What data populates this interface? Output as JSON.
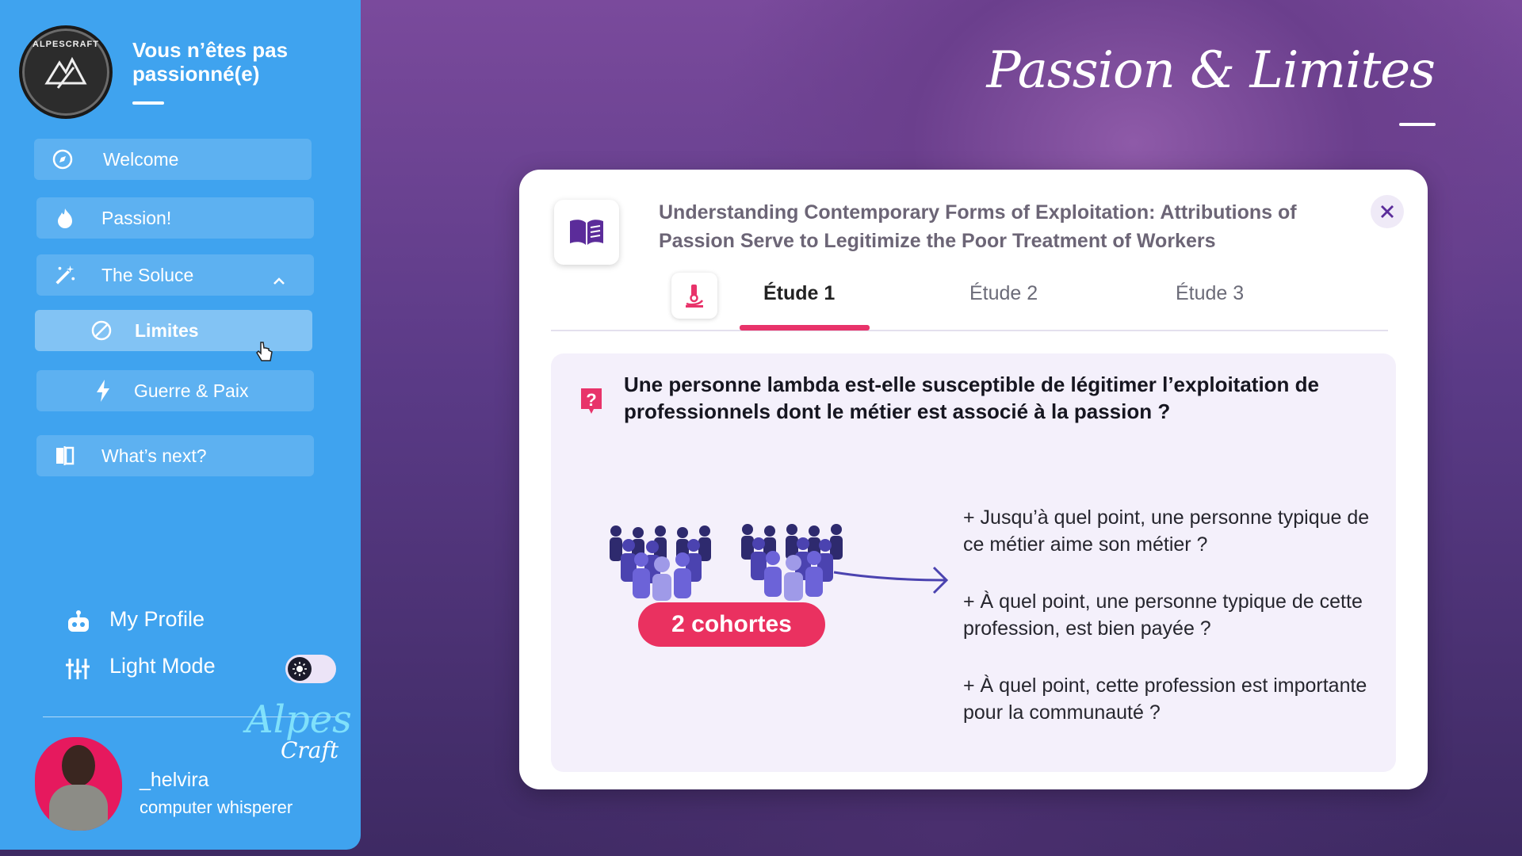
{
  "sidebar": {
    "logo_text": "ALPESCRAFT",
    "title": "Vous n’êtes pas passionné(e)",
    "nav": {
      "welcome": "Welcome",
      "passion": "Passion!",
      "soluce": "The Soluce",
      "limites": "Limites",
      "guerre": "Guerre & Paix",
      "whats_next": "What’s next?"
    },
    "bottom": {
      "profile": "My Profile",
      "light_mode": "Light Mode"
    },
    "user": {
      "name": "_helvira",
      "role": "computer whisperer"
    },
    "signature": {
      "line1": "Alpes",
      "line2": "Craft"
    }
  },
  "header": {
    "title": "Passion & Limites"
  },
  "card": {
    "title": "Understanding Contemporary Forms of Exploitation: Attributions of Passion Serve to Legitimize the Poor Treatment of Workers",
    "tabs": [
      "Étude 1",
      "Étude 2",
      "Étude 3"
    ],
    "question": "Une personne lambda est-elle susceptible de légitimer l’exploitation de professionnels dont le métier est associé à la passion ?",
    "cohorts_label": "2 cohortes",
    "points": [
      "+ Jusqu’à quel point, une personne typique de ce métier aime son métier ?",
      " + À quel point, une personne typique de cette profession, est bien payée ?",
      " + À quel point, cette profession est importante pour la communauté ?"
    ]
  },
  "colors": {
    "sidebar": "#3fa3ef",
    "accent_pink": "#e8336a",
    "icon_purple": "#5b2c9a"
  },
  "icons": [
    "compass-icon",
    "flame-icon",
    "magic-wand-icon",
    "ban-icon",
    "bolt-icon",
    "book-split-icon",
    "robot-icon",
    "sliders-icon",
    "sun-icon",
    "book-open-icon",
    "close-icon",
    "microscope-icon",
    "question-icon",
    "arrow-right-icon"
  ]
}
